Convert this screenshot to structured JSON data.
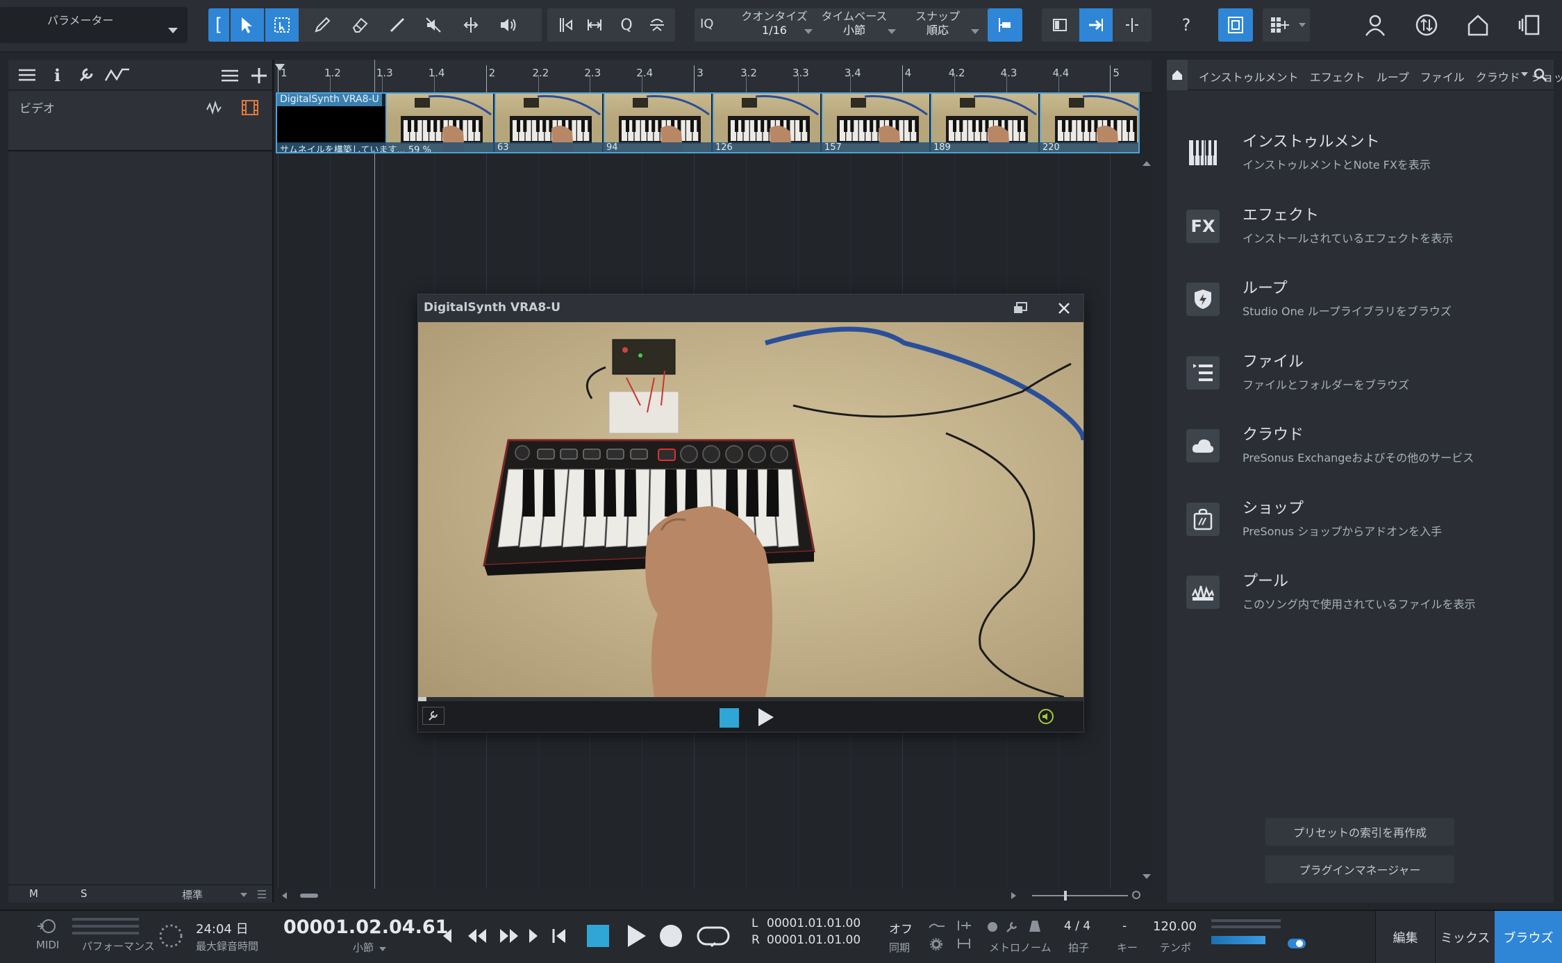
{
  "toolbar": {
    "parameter_label": "パラメーター",
    "quantize_label": "クオンタイズ",
    "quantize_value": "1/16",
    "timebase_label": "タイムベース",
    "timebase_value": "小節",
    "snap_label": "スナップ",
    "snap_value": "順応",
    "iq_label": "IQ",
    "help_label": "?"
  },
  "track": {
    "name": "ビデオ",
    "m_label": "M",
    "s_label": "S",
    "preset": "標準"
  },
  "ruler": {
    "ticks": [
      "1",
      "1.2",
      "1.3",
      "1.4",
      "2",
      "2.2",
      "2.3",
      "2.4",
      "3",
      "3.2",
      "3.3",
      "3.4",
      "4",
      "4.2",
      "4.3",
      "4.4",
      "5"
    ]
  },
  "clip": {
    "name": "DigitalSynth VRA8-U",
    "status": "サムネイルを構築しています... 59 %",
    "frame_numbers": [
      "63",
      "94",
      "126",
      "157",
      "189",
      "220"
    ]
  },
  "video_window": {
    "title": "DigitalSynth VRA8-U"
  },
  "browser": {
    "tabs": [
      "インストゥルメント",
      "エフェクト",
      "ループ",
      "ファイル",
      "クラウド",
      "ショップ",
      "プ"
    ],
    "items": [
      {
        "title": "インストゥルメント",
        "sub": "インストゥルメントとNote FXを表示",
        "icon": "piano-keys-icon"
      },
      {
        "title": "エフェクト",
        "sub": "インストールされているエフェクトを表示",
        "icon": "fx-icon",
        "icon_text": "FX"
      },
      {
        "title": "ループ",
        "sub": "Studio One ループライブラリをブラウズ",
        "icon": "loop-shield-icon"
      },
      {
        "title": "ファイル",
        "sub": "ファイルとフォルダーをブラウズ",
        "icon": "file-list-icon"
      },
      {
        "title": "クラウド",
        "sub": "PreSonus Exchangeおよびその他のサービス",
        "icon": "cloud-icon"
      },
      {
        "title": "ショップ",
        "sub": "PreSonus ショップからアドオンを入手",
        "icon": "shop-bag-icon"
      },
      {
        "title": "プール",
        "sub": "このソング内で使用されているファイルを表示",
        "icon": "pool-wave-icon"
      }
    ],
    "reindex_button": "プリセットの索引を再作成",
    "plugin_manager_button": "プラグインマネージャー"
  },
  "transport": {
    "midi_label": "MIDI",
    "performance_label": "パフォーマンス",
    "record_time": "24:04 日",
    "record_time_label": "最大録音時間",
    "position": "00001.02.04.61",
    "position_unit": "小節",
    "loop_l_label": "L",
    "loop_l": "00001.01.01.00",
    "loop_r_label": "R",
    "loop_r": "00001.01.01.00",
    "sync_value": "オフ",
    "sync_label": "同期",
    "metronome_label": "メトロノーム",
    "time_sig": "4 / 4",
    "time_sig_label": "拍子",
    "key_value": "-",
    "key_label": "キー",
    "tempo": "120.00",
    "tempo_label": "テンポ",
    "edit_tab": "編集",
    "mix_tab": "ミックス",
    "browse_tab": "ブラウズ"
  },
  "colors": {
    "accent_blue": "#2f86d6",
    "clip_border": "#4fa3d8",
    "record_orange": "#e07a3a",
    "stop_cyan": "#2fa6d6"
  }
}
